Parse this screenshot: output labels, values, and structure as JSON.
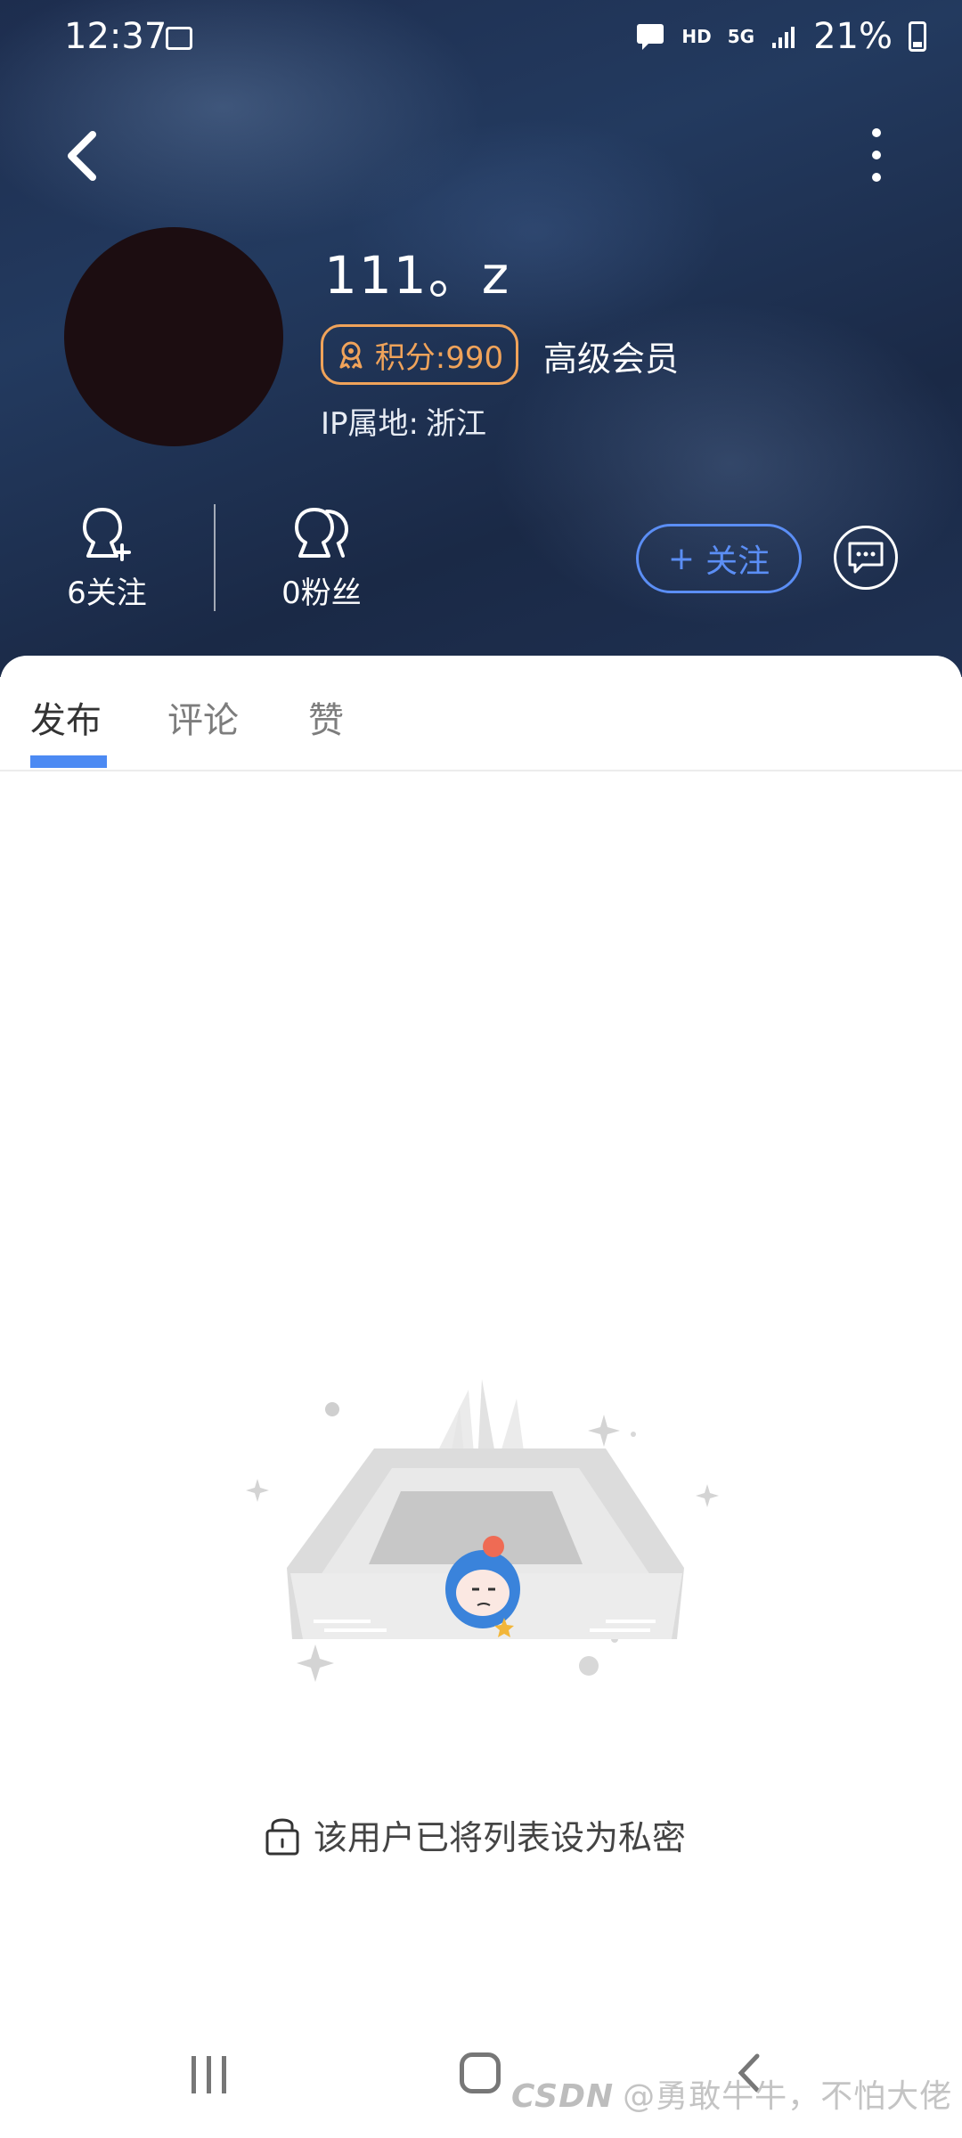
{
  "status_bar": {
    "time": "12:37",
    "network": "HD",
    "signal_type": "5G",
    "battery": "21%"
  },
  "header": {
    "back_icon": "chevron-left-icon",
    "more_icon": "more-vertical-icon"
  },
  "profile": {
    "name": "111。z",
    "points_badge": "积分:990",
    "member_level": "高级会员",
    "ip_label": "IP属地:",
    "ip_location": "浙江"
  },
  "stats": {
    "following": "6关注",
    "followers": "0粉丝"
  },
  "actions": {
    "follow_label": "关注",
    "follow_plus": "+"
  },
  "tabs": [
    {
      "label": "发布",
      "active": true
    },
    {
      "label": "评论",
      "active": false
    },
    {
      "label": "赞",
      "active": false
    }
  ],
  "empty_state": {
    "message": "该用户已将列表设为私密"
  },
  "watermark": "@勇敢牛牛，不怕大佬",
  "colors": {
    "accent": "#4c8af3",
    "badge": "#f0a35a",
    "hero_bg": "#1f3152"
  }
}
